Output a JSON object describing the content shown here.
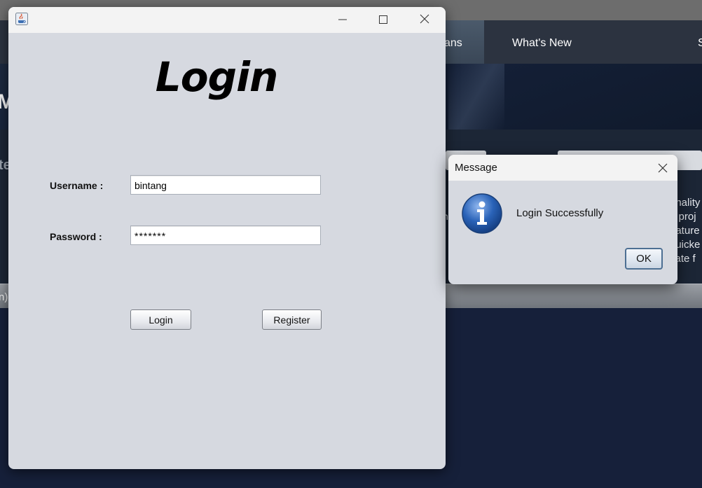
{
  "background": {
    "nav_partial": "ans",
    "nav_whats_new": "What's New",
    "nav_right_partial": "S",
    "hero_partial": "My",
    "left_partial": "te",
    "bar_partial": "n)",
    "side_partial": "n",
    "right_lines": [
      "onality",
      "g proj",
      "eature",
      "quicke",
      "vate f"
    ]
  },
  "login": {
    "title": "Login",
    "username_label": "Username  :",
    "username_value": "bintang",
    "password_label": "Password :",
    "password_value": "*******",
    "login_button": "Login",
    "register_button": "Register"
  },
  "dialog": {
    "title": "Message",
    "message": "Login Successfully",
    "ok_button": "OK"
  },
  "colors": {
    "window_bg": "#d6d9e0",
    "dialog_icon": "#2a63b8"
  }
}
